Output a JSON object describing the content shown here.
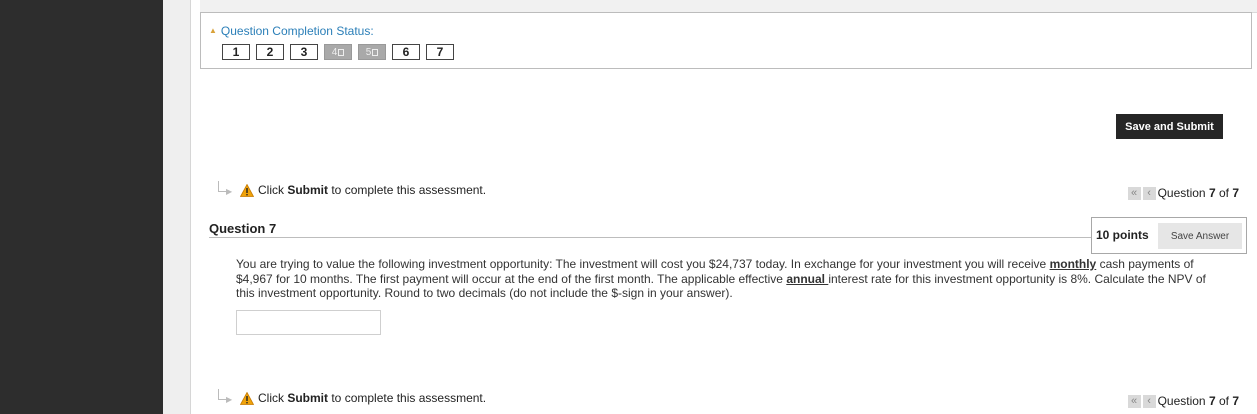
{
  "status": {
    "title": "Question Completion Status:",
    "questions": [
      {
        "label": "1",
        "saved": false
      },
      {
        "label": "2",
        "saved": false
      },
      {
        "label": "3",
        "saved": false
      },
      {
        "label": "4",
        "saved": true
      },
      {
        "label": "5",
        "saved": true
      },
      {
        "label": "6",
        "saved": false
      },
      {
        "label": "7",
        "saved": false
      }
    ]
  },
  "actions": {
    "save_submit": "Save and Submit"
  },
  "submit_notice": {
    "prefix": "Click ",
    "keyword": "Submit",
    "suffix": " to complete this assessment."
  },
  "pager": {
    "prefix": "Question ",
    "current": "7",
    "of": " of ",
    "total": "7"
  },
  "question": {
    "heading": "Question 7",
    "points": "10 points",
    "save_answer": "Save Answer",
    "text_part1": "You are trying to value the following investment opportunity: The investment will cost you $24,737 today. In exchange for your investment you will receive ",
    "text_em1": "monthly",
    "text_part2": " cash payments of $4,967 for 10 months. The first payment will occur at the end of the first month. The applicable effective ",
    "text_em2": "annual ",
    "text_part3": "interest rate for this investment opportunity is 8%. Calculate the NPV of this investment opportunity. Round to two decimals (do not include the $-sign in your answer).",
    "answer_value": ""
  },
  "colors": {
    "sidebar": "#2d2d2d",
    "link": "#2b7fb8",
    "primary_button": "#262626"
  }
}
